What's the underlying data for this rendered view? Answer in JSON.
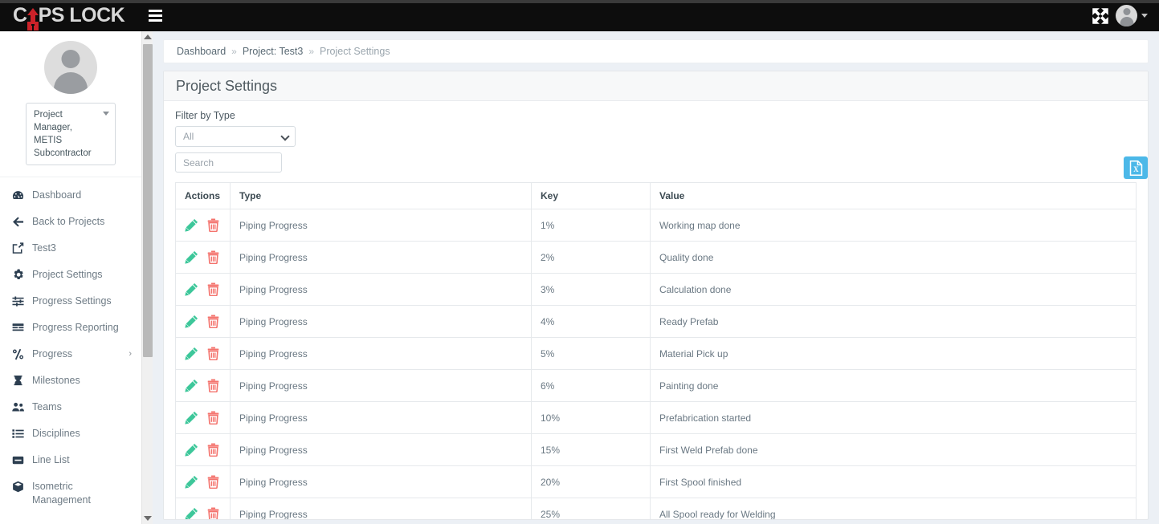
{
  "header": {
    "brand_prefix": "C",
    "brand_suffix": "PS LOCK",
    "menu_icon": "hamburger-icon",
    "fullscreen_icon": "fullscreen-expand-icon",
    "avatar_icon": "user-avatar-icon"
  },
  "sidebar": {
    "role_value": "Project Manager, METIS Subcontractor",
    "items": [
      {
        "label": "Dashboard",
        "icon": "dashboard-icon"
      },
      {
        "label": "Back to Projects",
        "icon": "arrow-left-icon"
      },
      {
        "label": "Test3",
        "icon": "edit-square-icon"
      },
      {
        "label": "Project Settings",
        "icon": "gear-icon"
      },
      {
        "label": "Progress Settings",
        "icon": "sliders-icon"
      },
      {
        "label": "Progress Reporting",
        "icon": "list-alt-icon"
      },
      {
        "label": "Progress",
        "icon": "percent-icon",
        "chevron": "›"
      },
      {
        "label": "Milestones",
        "icon": "hourglass-icon"
      },
      {
        "label": "Teams",
        "icon": "users-icon"
      },
      {
        "label": "Disciplines",
        "icon": "list-icon"
      },
      {
        "label": "Line List",
        "icon": "minus-square-icon"
      },
      {
        "label": "Isometric Management",
        "icon": "cube-icon"
      }
    ]
  },
  "breadcrumb": {
    "items": [
      {
        "label": "Dashboard",
        "active": false
      },
      {
        "label": "Project: Test3",
        "active": false
      },
      {
        "label": "Project Settings",
        "active": true
      }
    ],
    "separator": "»"
  },
  "page": {
    "title": "Project Settings"
  },
  "filters": {
    "type_label": "Filter by Type",
    "type_value": "All",
    "type_options": [
      "All"
    ],
    "search_placeholder": "Search",
    "search_value": "",
    "export_icon": "excel-export-icon"
  },
  "table": {
    "columns": [
      "Actions",
      "Type",
      "Key",
      "Value"
    ],
    "action_icons": {
      "edit": "pencil-icon",
      "delete": "trash-icon"
    },
    "action_colors": {
      "edit": "#3dc79a",
      "delete": "#f4736d"
    },
    "rows": [
      {
        "type": "Piping Progress",
        "key": "1%",
        "value": "Working map done"
      },
      {
        "type": "Piping Progress",
        "key": "2%",
        "value": "Quality done"
      },
      {
        "type": "Piping Progress",
        "key": "3%",
        "value": "Calculation done"
      },
      {
        "type": "Piping Progress",
        "key": "4%",
        "value": "Ready Prefab"
      },
      {
        "type": "Piping Progress",
        "key": "5%",
        "value": "Material Pick up"
      },
      {
        "type": "Piping Progress",
        "key": "6%",
        "value": "Painting done"
      },
      {
        "type": "Piping Progress",
        "key": "10%",
        "value": "Prefabrication started"
      },
      {
        "type": "Piping Progress",
        "key": "15%",
        "value": "First Weld Prefab done"
      },
      {
        "type": "Piping Progress",
        "key": "20%",
        "value": "First Spool finished"
      },
      {
        "type": "Piping Progress",
        "key": "25%",
        "value": "All Spool ready for Welding"
      }
    ]
  },
  "colors": {
    "header_bg": "#0d0d0d",
    "brand_accent": "#cc2229",
    "body_bg": "#ecf0f5",
    "export_btn": "#4cb8e8"
  }
}
